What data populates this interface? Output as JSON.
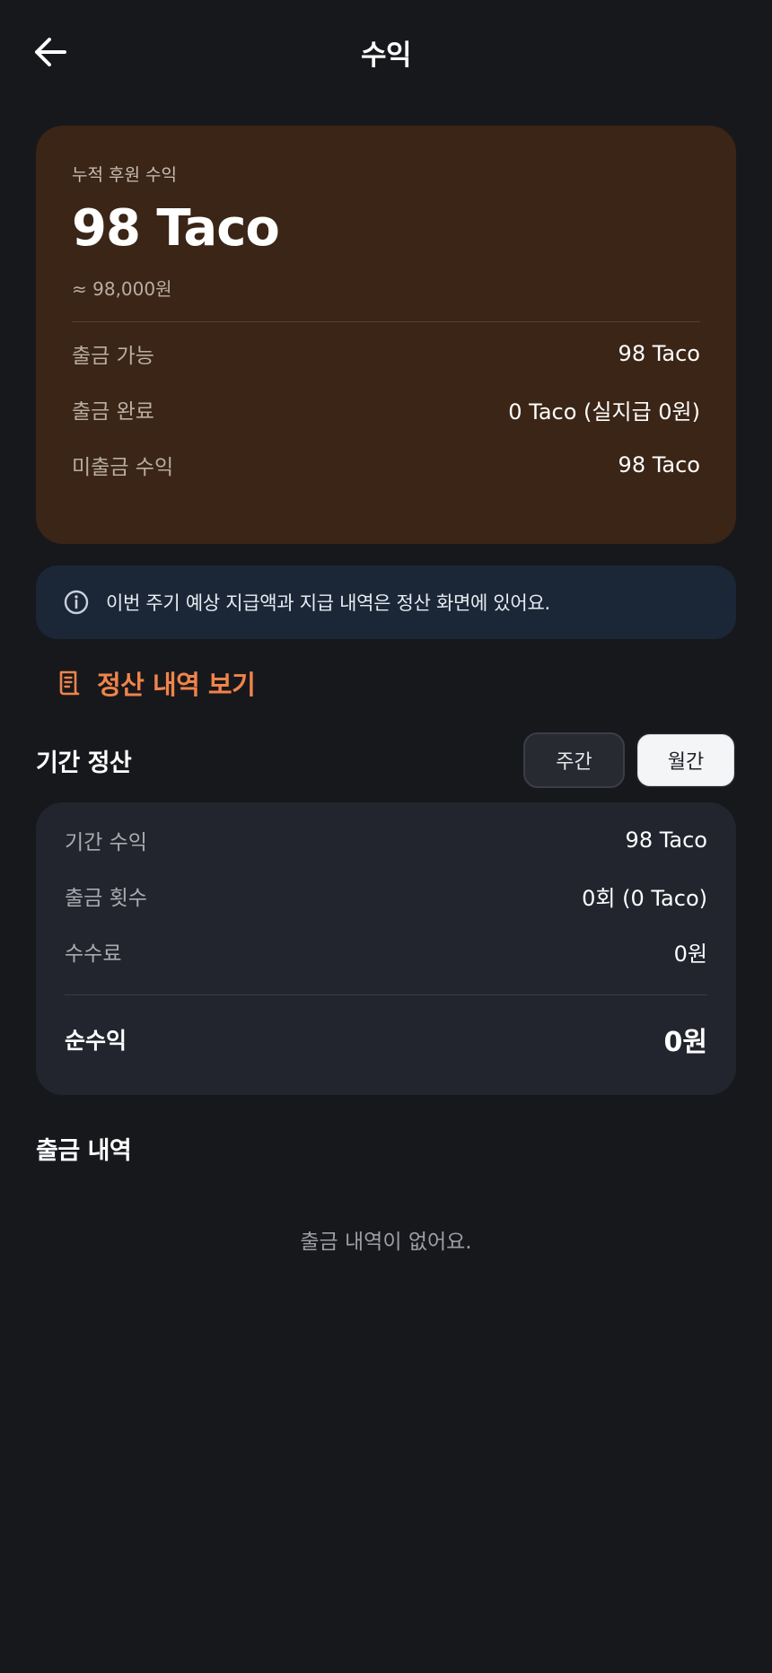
{
  "header": {
    "title": "수익"
  },
  "earnings": {
    "label": "누적 후원 수익",
    "amount": "98 Taco",
    "krw_equivalent": "≈ 98,000원",
    "rows": [
      {
        "label": "출금 가능",
        "value": "98 Taco"
      },
      {
        "label": "출금 완료",
        "value": "0 Taco (실지급 0원)"
      },
      {
        "label": "미출금 수익",
        "value": "98 Taco"
      }
    ]
  },
  "info": {
    "text": "이번 주기 예상 지급액과 지급 내역은 정산 화면에 있어요."
  },
  "settlement_link": {
    "label": "정산 내역 보기"
  },
  "period": {
    "title": "기간 정산",
    "tabs": [
      {
        "label": "주간",
        "selected": false
      },
      {
        "label": "월간",
        "selected": true
      }
    ],
    "rows": [
      {
        "label": "기간 수익",
        "value": "98 Taco"
      },
      {
        "label": "출금 횟수",
        "value": "0회 (0 Taco)"
      },
      {
        "label": "수수료",
        "value": "0원"
      }
    ],
    "net": {
      "label": "순수익",
      "value": "0원"
    }
  },
  "withdrawals": {
    "title": "출금 내역",
    "empty_message": "출금 내역이 없어요."
  },
  "colors": {
    "background": "#17181c",
    "earnings_card": "#3b2516",
    "info_box": "#1b2737",
    "accent": "#f0844a",
    "period_card": "#22252e"
  },
  "icons": {
    "back": "arrow-left-icon",
    "info": "info-circle-icon",
    "receipt": "receipt-icon"
  }
}
